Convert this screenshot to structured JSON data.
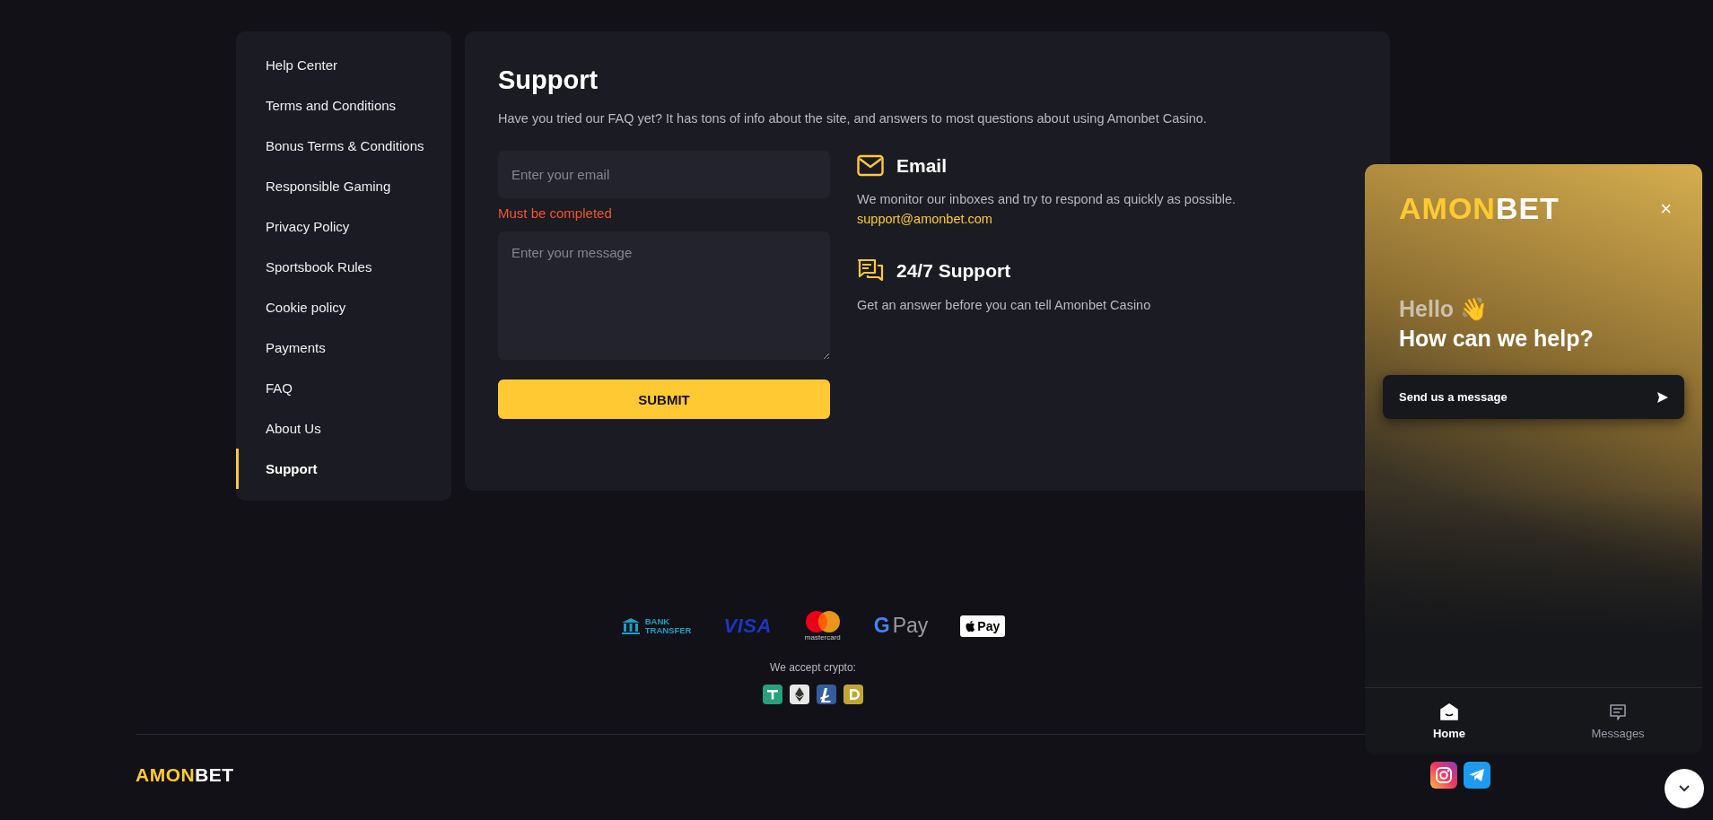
{
  "sidebar": {
    "items": [
      {
        "label": "Help Center",
        "selected": false
      },
      {
        "label": "Terms and Conditions",
        "selected": false
      },
      {
        "label": "Bonus Terms & Conditions",
        "selected": false
      },
      {
        "label": "Responsible Gaming",
        "selected": false
      },
      {
        "label": "Privacy Policy",
        "selected": false
      },
      {
        "label": "Sportsbook Rules",
        "selected": false
      },
      {
        "label": "Cookie policy",
        "selected": false
      },
      {
        "label": "Payments",
        "selected": false
      },
      {
        "label": "FAQ",
        "selected": false
      },
      {
        "label": "About Us",
        "selected": false
      },
      {
        "label": "Support",
        "selected": true
      }
    ]
  },
  "support": {
    "title": "Support",
    "intro": "Have you tried our FAQ yet? It has tons of info about the site, and answers to most questions about using Amonbet Casino.",
    "email_field": {
      "placeholder": "Enter your email",
      "error": "Must be completed"
    },
    "message_field": {
      "placeholder": "Enter your message"
    },
    "submit": "SUBMIT",
    "contacts": [
      {
        "kind": "email",
        "title": "Email",
        "text": "We monitor our inboxes and try to respond as quickly as possible.",
        "link": "support@amonbet.com"
      },
      {
        "kind": "chat",
        "title": "24/7 Support",
        "text": "Get an answer before you can tell Amonbet Casino"
      }
    ]
  },
  "payments": [
    {
      "kind": "bank",
      "lines": [
        "BANK",
        "TRANSFER"
      ]
    },
    {
      "kind": "visa",
      "label": "VISA"
    },
    {
      "kind": "mastercard",
      "label": "mastercard"
    },
    {
      "kind": "gpay",
      "mark": "G",
      "label": "Pay"
    },
    {
      "kind": "applepay",
      "label": "Pay"
    }
  ],
  "crypto": {
    "label": "We accept crypto:",
    "coins": [
      {
        "kind": "tether",
        "color": "#26a17b"
      },
      {
        "kind": "ether",
        "color": "#e8e8e8"
      },
      {
        "kind": "lite",
        "color": "#345d9d"
      },
      {
        "kind": "doge",
        "color": "#c2a633"
      }
    ]
  },
  "footer": {
    "logo": {
      "part_1": "AMON",
      "part_2": "BET"
    },
    "socials": [
      {
        "kind": "instagram"
      },
      {
        "kind": "telegram"
      }
    ]
  },
  "chat_widget": {
    "logo": {
      "part_1": "AMON",
      "part_2": "BET"
    },
    "close": "×",
    "hello": "Hello 👋",
    "question": "How can we help?",
    "send": "Send us a message",
    "nav": [
      {
        "label": "Home",
        "kind": "home",
        "selected": true
      },
      {
        "label": "Messages",
        "kind": "messages",
        "selected": false
      }
    ]
  }
}
